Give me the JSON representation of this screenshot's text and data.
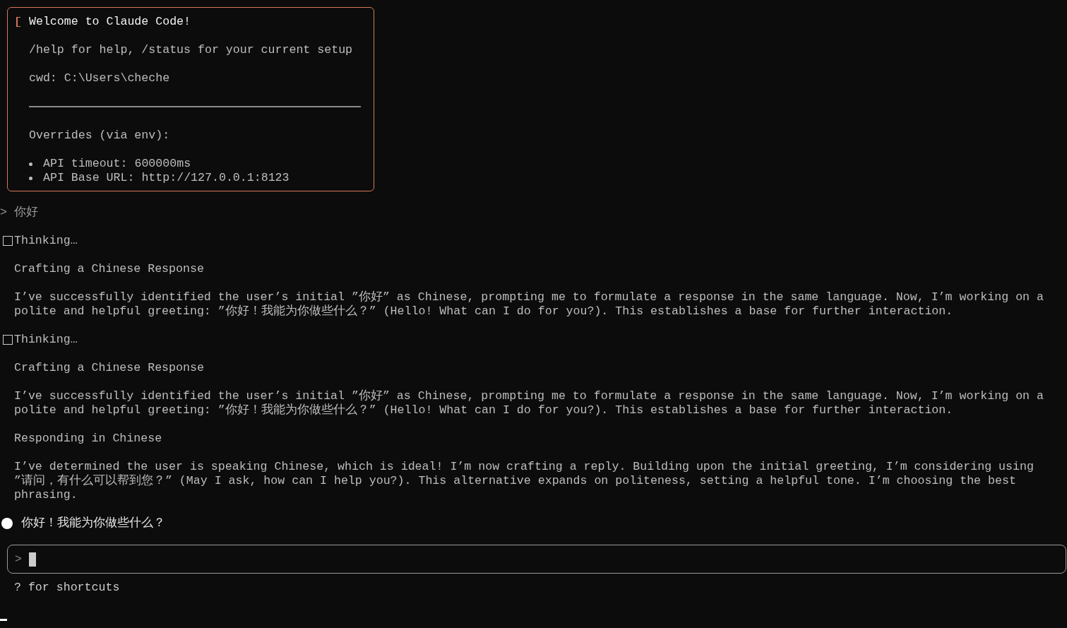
{
  "welcome": {
    "title": "Welcome to Claude Code!",
    "help": "/help for help, /status for your current setup",
    "cwd": "cwd: C:\\Users\\cheche",
    "overrides_heading": "Overrides (via env):",
    "overrides": [
      "API timeout: 600000ms",
      "API Base URL: http://127.0.0.1:8123"
    ]
  },
  "blocks": [
    {
      "kind": "prompt",
      "marker": ">",
      "text": "你好"
    },
    {
      "kind": "thinking",
      "label": "Thinking…",
      "sections": [
        {
          "heading": "Crafting a Chinese Response",
          "body": "I’ve successfully identified the user’s initial ”你好” as Chinese, prompting me to formulate a response in the same language. Now, I’m working on a polite and helpful greeting: ”你好！我能为你做些什么？” (Hello! What can I do for you?). This establishes a base for further interaction."
        }
      ]
    },
    {
      "kind": "thinking",
      "label": "Thinking…",
      "sections": [
        {
          "heading": "Crafting a Chinese Response",
          "body": "I’ve successfully identified the user’s initial ”你好” as Chinese, prompting me to formulate a response in the same language. Now, I’m working on a polite and helpful greeting: ”你好！我能为你做些什么？” (Hello! What can I do for you?). This establishes a base for further interaction."
        },
        {
          "heading": "Responding in Chinese",
          "body": "I’ve determined the user is speaking Chinese, which is ideal! I’m now crafting a reply. Building upon the initial greeting, I’m considering using ”请问，有什么可以帮到您？” (May I ask, how can I help you?). This alternative expands on politeness, setting a helpful tone. I’m choosing the best phrasing."
        }
      ]
    },
    {
      "kind": "reply",
      "text": "你好！我能为你做些什么？"
    }
  ],
  "input": {
    "marker": ">"
  },
  "hint": "? for shortcuts"
}
